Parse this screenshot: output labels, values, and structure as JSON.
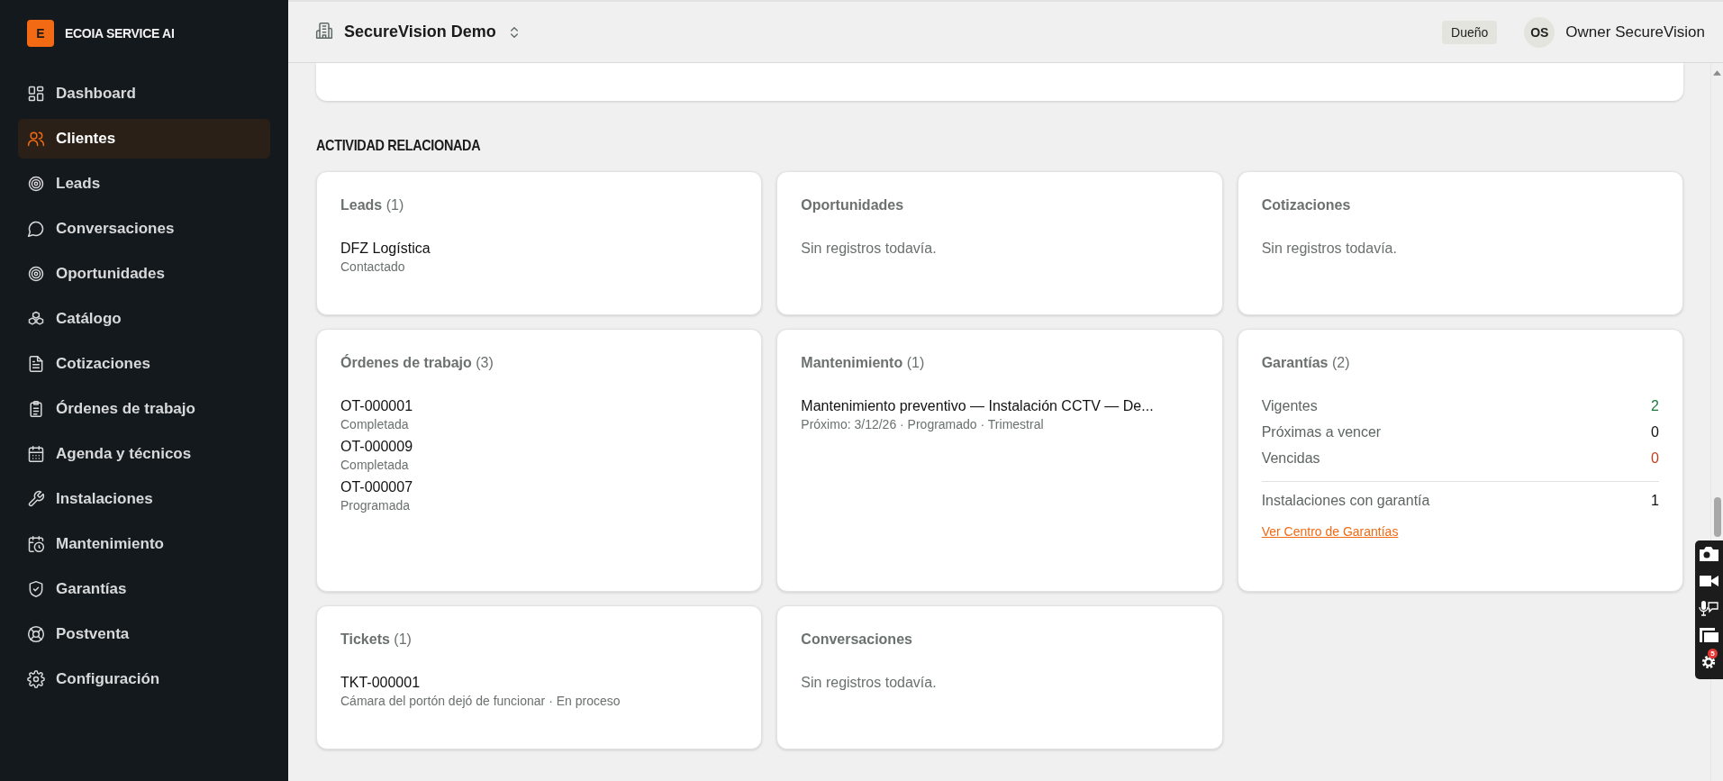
{
  "brand": {
    "logo_letter": "E",
    "name": "ECOIA SERVICE AI"
  },
  "sidebar": {
    "items": [
      {
        "label": "Dashboard",
        "selected": false
      },
      {
        "label": "Clientes",
        "selected": true
      },
      {
        "label": "Leads",
        "selected": false
      },
      {
        "label": "Conversaciones",
        "selected": false
      },
      {
        "label": "Oportunidades",
        "selected": false
      },
      {
        "label": "Catálogo",
        "selected": false
      },
      {
        "label": "Cotizaciones",
        "selected": false
      },
      {
        "label": "Órdenes de trabajo",
        "selected": false
      },
      {
        "label": "Agenda y técnicos",
        "selected": false
      },
      {
        "label": "Instalaciones",
        "selected": false
      },
      {
        "label": "Mantenimiento",
        "selected": false
      },
      {
        "label": "Garantías",
        "selected": false
      },
      {
        "label": "Postventa",
        "selected": false
      },
      {
        "label": "Configuración",
        "selected": false
      }
    ]
  },
  "header": {
    "workspace": "SecureVision Demo",
    "role_badge": "Dueño",
    "avatar_initials": "OS",
    "user_name": "Owner SecureVision"
  },
  "section_title": "ACTIVIDAD RELACIONADA",
  "cards": [
    {
      "kind": "list",
      "title": "**Leads** (1)",
      "items": [
        {
          "name": "DFZ Logística",
          "detail": "Contactado"
        }
      ]
    },
    {
      "kind": "empty",
      "title": "**Oportunidades**",
      "message": "Sin registros todavía."
    },
    {
      "kind": "empty",
      "title": "**Cotizaciones**",
      "message": "Sin registros todavía."
    },
    {
      "kind": "list",
      "title": "**Órdenes de trabajo** (3)",
      "items": [
        {
          "name": "OT-000001",
          "detail": "Completada"
        },
        {
          "name": "OT-000009",
          "detail": "Completada"
        },
        {
          "name": "OT-000007",
          "detail": "Programada"
        }
      ]
    },
    {
      "kind": "list",
      "title": "**Mantenimiento** (1)",
      "items": [
        {
          "name": "Mantenimiento preventivo — Instalación CCTV — De...",
          "detail": "Próximo: 3/12/26 · Programado · Trimestral"
        }
      ]
    },
    {
      "kind": "warranty",
      "title": "**Garantías** (2)",
      "stats": [
        {
          "label": "Vigentes",
          "value": "2",
          "color": "#1f7a3f"
        },
        {
          "label": "Próximas a vencer",
          "value": "0",
          "color": "#111111"
        },
        {
          "label": "Vencidas",
          "value": "0",
          "color": "#c43d1c"
        }
      ],
      "total": {
        "label": "Instalaciones con garantía",
        "value": "1"
      },
      "link": "Ver Centro de Garantías"
    },
    {
      "kind": "list",
      "title": "**Tickets** (1)",
      "items": [
        {
          "name": "TKT-000001",
          "detail": "Cámara del portón dejó de funcionar · En proceso"
        }
      ]
    },
    {
      "kind": "empty",
      "title": "**Conversaciones**",
      "message": "Sin registros todavía."
    }
  ],
  "recorder_toolbar": {
    "badge": "5"
  }
}
